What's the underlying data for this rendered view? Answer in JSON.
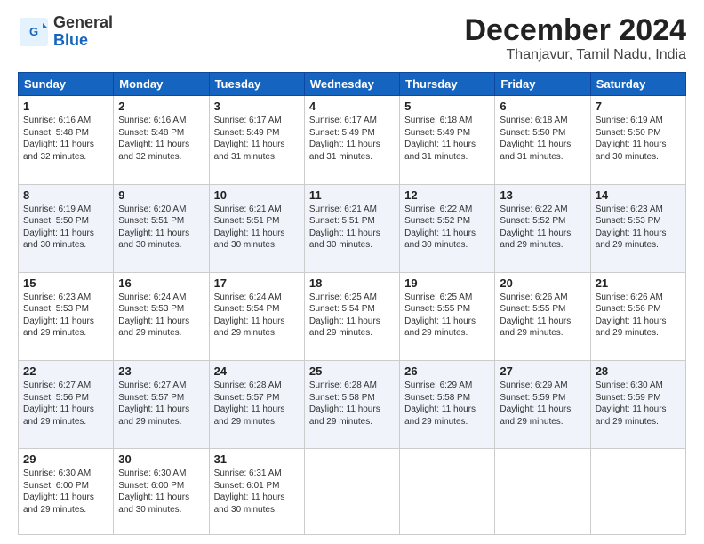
{
  "header": {
    "logo_line1": "General",
    "logo_line2": "Blue",
    "month": "December 2024",
    "location": "Thanjavur, Tamil Nadu, India"
  },
  "weekdays": [
    "Sunday",
    "Monday",
    "Tuesday",
    "Wednesday",
    "Thursday",
    "Friday",
    "Saturday"
  ],
  "weeks": [
    [
      {
        "day": "1",
        "info": "Sunrise: 6:16 AM\nSunset: 5:48 PM\nDaylight: 11 hours\nand 32 minutes."
      },
      {
        "day": "2",
        "info": "Sunrise: 6:16 AM\nSunset: 5:48 PM\nDaylight: 11 hours\nand 32 minutes."
      },
      {
        "day": "3",
        "info": "Sunrise: 6:17 AM\nSunset: 5:49 PM\nDaylight: 11 hours\nand 31 minutes."
      },
      {
        "day": "4",
        "info": "Sunrise: 6:17 AM\nSunset: 5:49 PM\nDaylight: 11 hours\nand 31 minutes."
      },
      {
        "day": "5",
        "info": "Sunrise: 6:18 AM\nSunset: 5:49 PM\nDaylight: 11 hours\nand 31 minutes."
      },
      {
        "day": "6",
        "info": "Sunrise: 6:18 AM\nSunset: 5:50 PM\nDaylight: 11 hours\nand 31 minutes."
      },
      {
        "day": "7",
        "info": "Sunrise: 6:19 AM\nSunset: 5:50 PM\nDaylight: 11 hours\nand 30 minutes."
      }
    ],
    [
      {
        "day": "8",
        "info": "Sunrise: 6:19 AM\nSunset: 5:50 PM\nDaylight: 11 hours\nand 30 minutes."
      },
      {
        "day": "9",
        "info": "Sunrise: 6:20 AM\nSunset: 5:51 PM\nDaylight: 11 hours\nand 30 minutes."
      },
      {
        "day": "10",
        "info": "Sunrise: 6:21 AM\nSunset: 5:51 PM\nDaylight: 11 hours\nand 30 minutes."
      },
      {
        "day": "11",
        "info": "Sunrise: 6:21 AM\nSunset: 5:51 PM\nDaylight: 11 hours\nand 30 minutes."
      },
      {
        "day": "12",
        "info": "Sunrise: 6:22 AM\nSunset: 5:52 PM\nDaylight: 11 hours\nand 30 minutes."
      },
      {
        "day": "13",
        "info": "Sunrise: 6:22 AM\nSunset: 5:52 PM\nDaylight: 11 hours\nand 29 minutes."
      },
      {
        "day": "14",
        "info": "Sunrise: 6:23 AM\nSunset: 5:53 PM\nDaylight: 11 hours\nand 29 minutes."
      }
    ],
    [
      {
        "day": "15",
        "info": "Sunrise: 6:23 AM\nSunset: 5:53 PM\nDaylight: 11 hours\nand 29 minutes."
      },
      {
        "day": "16",
        "info": "Sunrise: 6:24 AM\nSunset: 5:53 PM\nDaylight: 11 hours\nand 29 minutes."
      },
      {
        "day": "17",
        "info": "Sunrise: 6:24 AM\nSunset: 5:54 PM\nDaylight: 11 hours\nand 29 minutes."
      },
      {
        "day": "18",
        "info": "Sunrise: 6:25 AM\nSunset: 5:54 PM\nDaylight: 11 hours\nand 29 minutes."
      },
      {
        "day": "19",
        "info": "Sunrise: 6:25 AM\nSunset: 5:55 PM\nDaylight: 11 hours\nand 29 minutes."
      },
      {
        "day": "20",
        "info": "Sunrise: 6:26 AM\nSunset: 5:55 PM\nDaylight: 11 hours\nand 29 minutes."
      },
      {
        "day": "21",
        "info": "Sunrise: 6:26 AM\nSunset: 5:56 PM\nDaylight: 11 hours\nand 29 minutes."
      }
    ],
    [
      {
        "day": "22",
        "info": "Sunrise: 6:27 AM\nSunset: 5:56 PM\nDaylight: 11 hours\nand 29 minutes."
      },
      {
        "day": "23",
        "info": "Sunrise: 6:27 AM\nSunset: 5:57 PM\nDaylight: 11 hours\nand 29 minutes."
      },
      {
        "day": "24",
        "info": "Sunrise: 6:28 AM\nSunset: 5:57 PM\nDaylight: 11 hours\nand 29 minutes."
      },
      {
        "day": "25",
        "info": "Sunrise: 6:28 AM\nSunset: 5:58 PM\nDaylight: 11 hours\nand 29 minutes."
      },
      {
        "day": "26",
        "info": "Sunrise: 6:29 AM\nSunset: 5:58 PM\nDaylight: 11 hours\nand 29 minutes."
      },
      {
        "day": "27",
        "info": "Sunrise: 6:29 AM\nSunset: 5:59 PM\nDaylight: 11 hours\nand 29 minutes."
      },
      {
        "day": "28",
        "info": "Sunrise: 6:30 AM\nSunset: 5:59 PM\nDaylight: 11 hours\nand 29 minutes."
      }
    ],
    [
      {
        "day": "29",
        "info": "Sunrise: 6:30 AM\nSunset: 6:00 PM\nDaylight: 11 hours\nand 29 minutes."
      },
      {
        "day": "30",
        "info": "Sunrise: 6:30 AM\nSunset: 6:00 PM\nDaylight: 11 hours\nand 30 minutes."
      },
      {
        "day": "31",
        "info": "Sunrise: 6:31 AM\nSunset: 6:01 PM\nDaylight: 11 hours\nand 30 minutes."
      },
      {
        "day": "",
        "info": ""
      },
      {
        "day": "",
        "info": ""
      },
      {
        "day": "",
        "info": ""
      },
      {
        "day": "",
        "info": ""
      }
    ]
  ]
}
